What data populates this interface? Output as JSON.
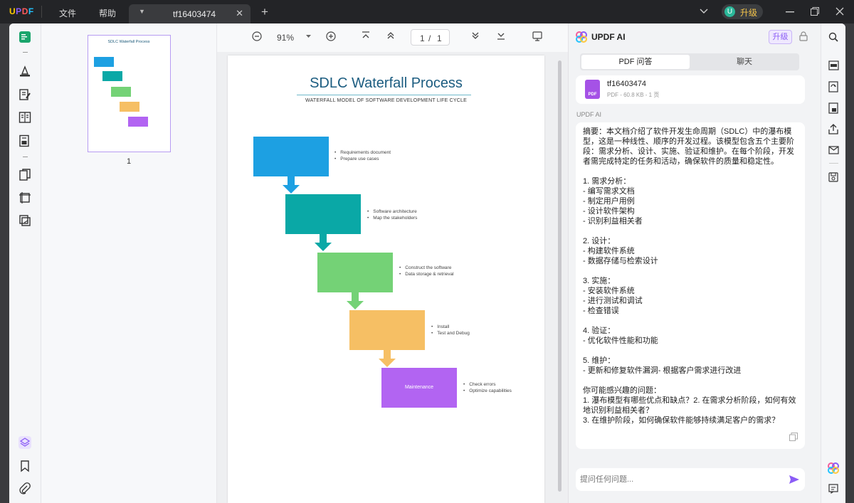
{
  "app": {
    "logo": [
      "U",
      "P",
      "D",
      "F"
    ],
    "menu": [
      "文件",
      "帮助"
    ],
    "upgrade_avatar": "U",
    "upgrade_label": "升级"
  },
  "tab": {
    "name": "tf16403474"
  },
  "viewer": {
    "zoom": "91%",
    "page_current": "1",
    "page_sep": "/",
    "page_total": "1"
  },
  "thumbnails": [
    {
      "page_number": "1",
      "title": "SDLC Waterfall Process"
    }
  ],
  "document": {
    "title": "SDLC Waterfall Process",
    "subtitle": "WATERFALL MODEL OF SOFTWARE DEVELOPMENT LIFE CYCLE",
    "steps": [
      {
        "color": "#1da0e2",
        "label": "",
        "bullets": [
          "Requirements document",
          "Prepare use cases"
        ]
      },
      {
        "color": "#0aa8a6",
        "label": "",
        "bullets": [
          "Software architecture",
          "Map the stakeholders"
        ]
      },
      {
        "color": "#74d276",
        "label": "",
        "bullets": [
          "Construct the software",
          "Data storage & retrieval"
        ]
      },
      {
        "color": "#f6bf64",
        "label": "",
        "bullets": [
          "Install",
          "Test and Debug"
        ]
      },
      {
        "color": "#b264f2",
        "label": "Maintenance",
        "bullets": [
          "Check errors",
          "Optimize capabilities"
        ]
      }
    ]
  },
  "ai": {
    "title": "UPDF AI",
    "upgrade_label": "升级",
    "tabs": [
      "PDF 问答",
      "聊天"
    ],
    "file": {
      "name": "tf16403474",
      "meta": "PDF - 60.8 KB - 1 页",
      "badge": "PDF"
    },
    "section_label": "UPDF AI",
    "answer": "摘要：本文档介绍了软件开发生命周期（SDLC）中的瀑布模型，这是一种线性、顺序的开发过程。该模型包含五个主要阶段：需求分析、设计、实施、验证和维护。在每个阶段，开发者需完成特定的任务和活动，确保软件的质量和稳定性。\n\n1. 需求分析：\n- 编写需求文档\n- 制定用户用例\n- 设计软件架构\n- 识别利益相关者\n\n2. 设计：\n- 构建软件系统\n- 数据存储与检索设计\n\n3. 实施：\n- 安装软件系统\n- 进行测试和调试\n- 检查错误\n\n4. 验证：\n- 优化软件性能和功能\n\n5. 维护：\n- 更新和修复软件漏洞- 根据客户需求进行改进\n\n你可能感兴趣的问题：\n1. 瀑布模型有哪些优点和缺点？2. 在需求分析阶段，如何有效地识别利益相关者？\n3. 在维护阶段，如何确保软件能够持续满足客户的需求？",
    "input_placeholder": "提问任何问题..."
  },
  "colors": {
    "accent": "#8b5cf6",
    "titlebar": "#232427"
  }
}
